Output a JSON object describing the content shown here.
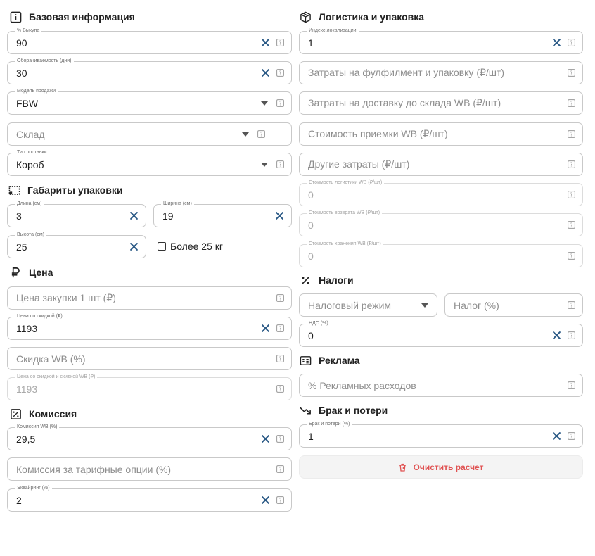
{
  "sections": {
    "basic": "Базовая информация",
    "dims": "Габариты упаковки",
    "price": "Цена",
    "commission": "Комиссия",
    "logistics": "Логистика и упаковка",
    "taxes": "Налоги",
    "ads": "Реклама",
    "defects": "Брак и потери"
  },
  "fields": {
    "buyout": {
      "label": "% Выкупа",
      "value": "90"
    },
    "turnover": {
      "label": "Оборачиваемость (дни)",
      "value": "30"
    },
    "sales_model": {
      "label": "Модель продажи",
      "value": "FBW"
    },
    "warehouse": {
      "placeholder": "Склад"
    },
    "supply_type": {
      "label": "Тип поставки",
      "value": "Короб"
    },
    "length": {
      "label": "Длина (см)",
      "value": "3"
    },
    "width": {
      "label": "Ширина (см)",
      "value": "19"
    },
    "height": {
      "label": "Высота (см)",
      "value": "25"
    },
    "over25": {
      "label": "Более 25 кг"
    },
    "purchase_price": {
      "placeholder": "Цена закупки 1 шт (₽)"
    },
    "discount_price": {
      "label": "Цена со скидкой (₽)",
      "value": "1193"
    },
    "wb_discount": {
      "placeholder": "Скидка WB (%)"
    },
    "final_price": {
      "label": "Цена со скидкой и скидкой WB (₽)",
      "value": "1193"
    },
    "wb_commission": {
      "label": "Комиссия WB (%)",
      "value": "29,5"
    },
    "tariff_commission": {
      "placeholder": "Комиссия за тарифные опции (%)"
    },
    "acquiring": {
      "label": "Эквайринг (%)",
      "value": "2"
    },
    "localization": {
      "label": "Индекс локализации",
      "value": "1"
    },
    "fulfillment": {
      "placeholder": "Затраты на фулфилмент и упаковку (₽/шт)"
    },
    "delivery": {
      "placeholder": "Затраты на доставку до склада WB (₽/шт)"
    },
    "acceptance": {
      "placeholder": "Стоимость приемки WB (₽/шт)"
    },
    "other_costs": {
      "placeholder": "Другие затраты (₽/шт)"
    },
    "logistics_cost": {
      "label": "Стоимость логистики WB (₽/шт)",
      "value": "0"
    },
    "return_cost": {
      "label": "Стоимость возврата WB (₽/шт)",
      "value": "0"
    },
    "storage_cost": {
      "label": "Стоимость хранения WB (₽/шт)",
      "value": "0"
    },
    "tax_regime": {
      "placeholder": "Налоговый режим"
    },
    "tax": {
      "placeholder": "Налог (%)"
    },
    "vat": {
      "label": "НДС (%)",
      "value": "0"
    },
    "ad_spend": {
      "placeholder": "% Рекламных расходов"
    },
    "defects": {
      "label": "Брак и потери (%)",
      "value": "1"
    }
  },
  "actions": {
    "clear": "Очистить расчет"
  },
  "colors": {
    "clear_icon": "#2b5a86",
    "danger": "#e05252",
    "border": "#c9c9c9"
  }
}
